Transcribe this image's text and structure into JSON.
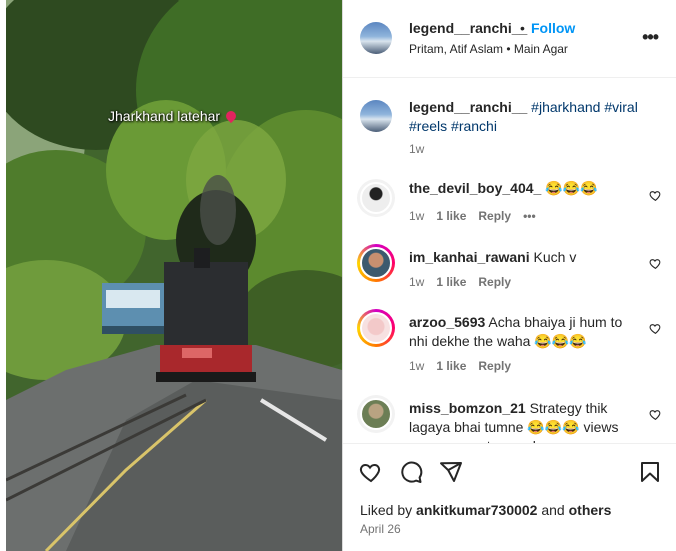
{
  "media": {
    "overlay_text": "Jharkhand latehar"
  },
  "header": {
    "username": "legend__ranchi__",
    "separator": "•",
    "follow_label": "Follow",
    "audio": "Pritam, Atif Aslam • Main Agar",
    "more_icon": "more-horizontal-icon"
  },
  "caption": {
    "username": "legend__ranchi__",
    "hashtags": [
      "#jharkhand",
      "#viral",
      "#reels",
      "#ranchi"
    ],
    "time": "1w"
  },
  "comments": [
    {
      "username": "the_devil_boy_404_",
      "text": "😂😂😂",
      "time": "1w",
      "likes": "1 like",
      "reply": "Reply",
      "more": "•••"
    },
    {
      "username": "im_kanhai_rawani",
      "text": "Kuch v",
      "time": "1w",
      "likes": "1 like",
      "reply": "Reply"
    },
    {
      "username": "arzoo_5693",
      "text": "Acha bhaiya ji hum to nhi dekhe the waha 😂😂😂",
      "time": "1w",
      "likes": "1 like",
      "reply": "Reply"
    },
    {
      "username": "miss_bomzon_21",
      "text": "Strategy thik lagaya bhai tumne 😂😂😂 views aur comments paneka"
    }
  ],
  "actions": {
    "like_icon": "heart-icon",
    "comment_icon": "comment-icon",
    "share_icon": "share-icon",
    "save_icon": "bookmark-icon"
  },
  "likes": {
    "prefix": "Liked by",
    "user": "ankitkumar730002",
    "conj": "and",
    "others": "others"
  },
  "date": "April 26",
  "colors": {
    "link_blue": "#0095f6",
    "hashtag": "#00376b",
    "muted": "#737373",
    "text": "#262626"
  }
}
